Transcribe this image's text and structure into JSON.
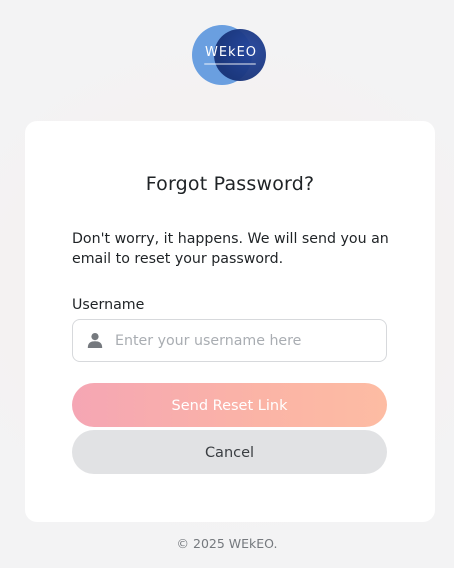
{
  "logo": {
    "text": "WEkEO",
    "brand_colors": {
      "light_circle": "#6a9fe0",
      "dark_circle": "#173277"
    }
  },
  "form": {
    "title": "Forgot Password?",
    "description": "Don't worry, it happens. We will send you an email to reset your password.",
    "username_label": "Username",
    "username_value": "",
    "username_placeholder": "Enter your username here",
    "username_icon": "user-icon",
    "send_label": "Send Reset Link",
    "cancel_label": "Cancel"
  },
  "colors": {
    "send_gradient_start": "#f5a6b4",
    "send_gradient_end": "#fdbca3",
    "cancel_bg": "#e1e2e4"
  },
  "footer": {
    "copyright": "© 2025 WEkEO."
  }
}
